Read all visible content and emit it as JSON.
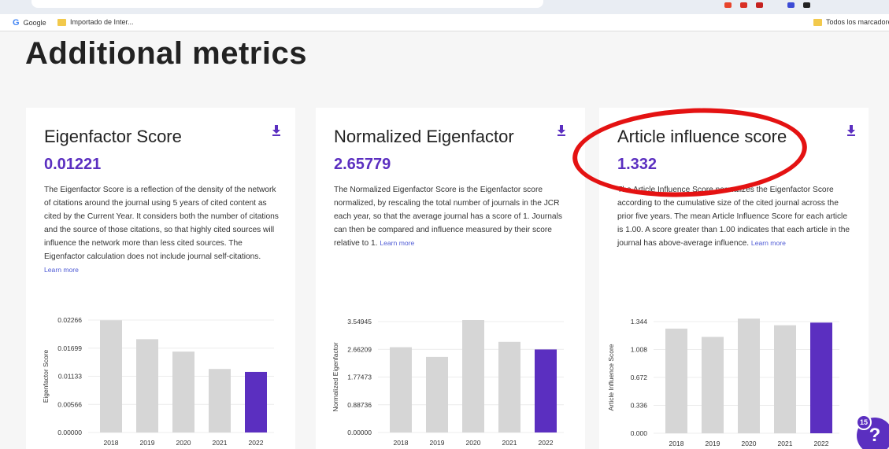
{
  "browser": {
    "bookmarks": [
      {
        "label": "Google",
        "icon": "google-icon"
      },
      {
        "label": "Importado de Inter...",
        "icon": "folder-icon"
      }
    ],
    "bookmarks_right": {
      "label": "Todos los marcadores",
      "icon": "folder-icon"
    }
  },
  "page": {
    "title": "Additional metrics",
    "accent": "#5b2fc0",
    "bar_color": "#d6d6d6",
    "highlight_color": "#e41212"
  },
  "cards": [
    {
      "title": "Eigenfactor Score",
      "value": "0.01221",
      "description": "The Eigenfactor Score is a reflection of the density of the network of citations around the journal using 5 years of cited content as cited by the Current Year. It considers both the number of citations and the source of those citations, so that highly cited sources will influence the network more than less cited sources. The Eigenfactor calculation does not include journal self-citations.",
      "learn_more": "Learn more",
      "download_icon": "download-icon"
    },
    {
      "title": "Normalized Eigenfactor",
      "value": "2.65779",
      "description": "The Normalized Eigenfactor Score is the Eigenfactor score normalized, by rescaling the total number of journals in the JCR each year, so that the average journal has a score of 1. Journals can then be compared and influence measured by their score relative to 1.",
      "learn_more": "Learn more",
      "download_icon": "download-icon"
    },
    {
      "title": "Article influence score",
      "value": "1.332",
      "description": "The Article Influence Score normalizes the Eigenfactor Score according to the cumulative size of the cited journal across the prior five years. The mean Article Influence Score for each article is 1.00. A score greater than 1.00 indicates that each article in the journal has above-average influence.",
      "learn_more": "Learn more",
      "download_icon": "download-icon"
    }
  ],
  "chart_data": [
    {
      "type": "bar",
      "ylabel": "Eigenfactor Score",
      "categories": [
        "2018",
        "2019",
        "2020",
        "2021",
        "2022"
      ],
      "values": [
        0.0226,
        0.0188,
        0.0163,
        0.0128,
        0.01221
      ],
      "yticks": [
        "0.02266",
        "0.01699",
        "0.01133",
        "0.00566",
        "0.00000"
      ],
      "ylim": [
        0,
        0.02266
      ],
      "highlight_index": 4
    },
    {
      "type": "bar",
      "ylabel": "Normalized Eigenfactor",
      "categories": [
        "2018",
        "2019",
        "2020",
        "2021",
        "2022"
      ],
      "values": [
        2.73,
        2.42,
        3.6,
        2.9,
        2.65779
      ],
      "yticks": [
        "3.54945",
        "2.66209",
        "1.77473",
        "0.88736",
        "0.00000"
      ],
      "ylim": [
        0,
        3.54945
      ],
      "highlight_index": 4
    },
    {
      "type": "bar",
      "ylabel": "Article Influence Score",
      "categories": [
        "2018",
        "2019",
        "2020",
        "2021",
        "2022"
      ],
      "values": [
        1.26,
        1.16,
        1.38,
        1.3,
        1.332
      ],
      "yticks": [
        "1.344",
        "1.008",
        "0.672",
        "0.336",
        "0.000"
      ],
      "ylim": [
        0,
        1.344
      ],
      "highlight_index": 4
    }
  ],
  "help": {
    "label": "?",
    "badge": "15"
  }
}
